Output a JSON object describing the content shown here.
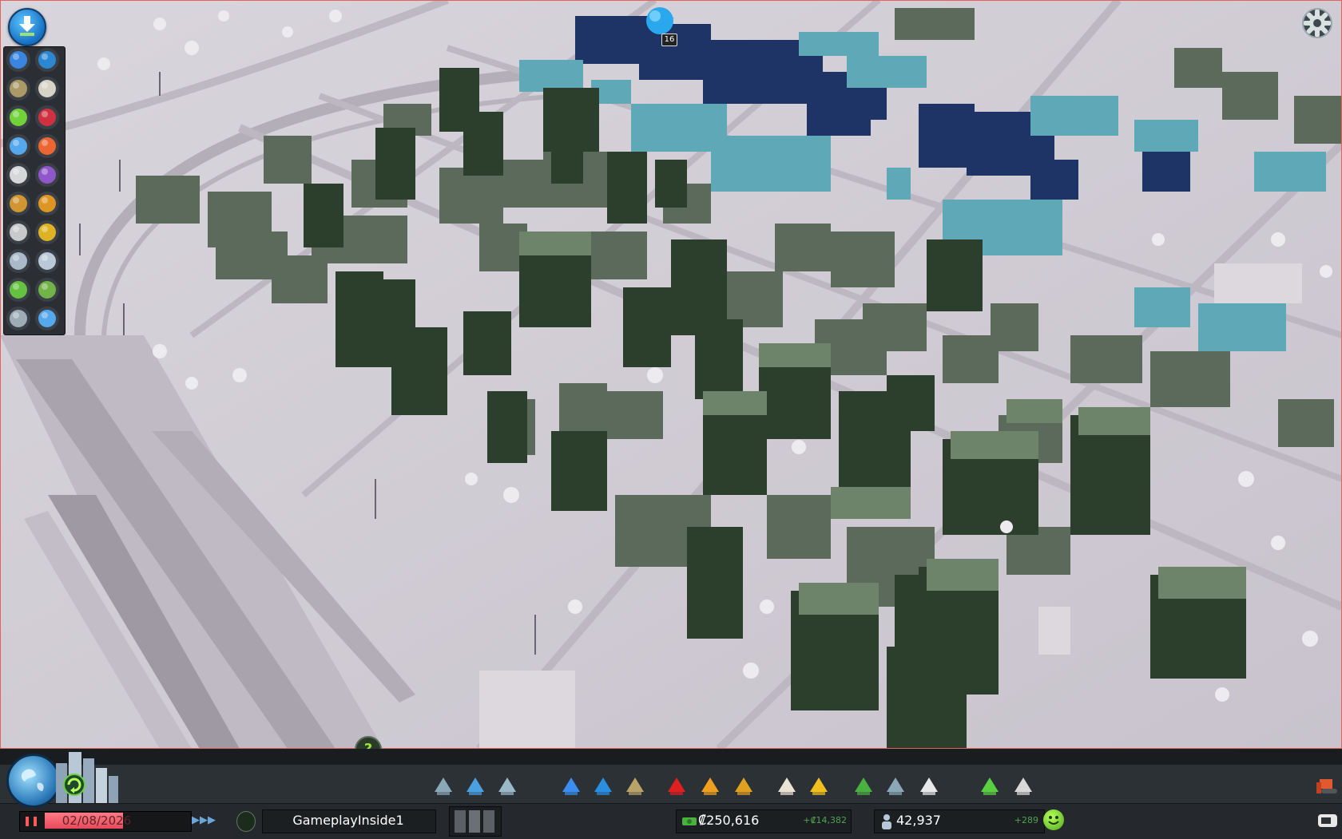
{
  "hud": {
    "date": "02/08/2026",
    "city_name": "GameplayInside1",
    "money": "₡250,616",
    "money_delta": "+₡14,382",
    "population": "42,937",
    "population_delta": "+289",
    "notification_count": "16",
    "help_label": "?"
  },
  "info_views": [
    {
      "icon": "electricity-icon",
      "color": "#3b8df0"
    },
    {
      "icon": "water-drop-icon",
      "color": "#2a8fe0"
    },
    {
      "icon": "garbage-icon",
      "color": "#b8a46a"
    },
    {
      "icon": "education-book-icon",
      "color": "#e9e3d4"
    },
    {
      "icon": "happiness-smiley-icon",
      "color": "#78e23a"
    },
    {
      "icon": "health-heart-icon",
      "color": "#e03040"
    },
    {
      "icon": "level-star-icon",
      "color": "#5ab4ff"
    },
    {
      "icon": "noise-cone-icon",
      "color": "#ff6a30"
    },
    {
      "icon": "traffic-car-icon",
      "color": "#e8e8e8"
    },
    {
      "icon": "pollution-canister-icon",
      "color": "#9a5ad8"
    },
    {
      "icon": "wind-magnet-icon",
      "color": "#e0a030"
    },
    {
      "icon": "fire-helmet-icon",
      "color": "#f0a020"
    },
    {
      "icon": "crime-mask-icon",
      "color": "#d8d8d8"
    },
    {
      "icon": "transport-bus-icon",
      "color": "#f0c020"
    },
    {
      "icon": "population-person-icon",
      "color": "#b8c8d8"
    },
    {
      "icon": "land-value-cube-icon",
      "color": "#c8d8e8"
    },
    {
      "icon": "economy-dollar-icon",
      "color": "#6ad040"
    },
    {
      "icon": "resources-leaf-icon",
      "color": "#78c048"
    },
    {
      "icon": "terrain-hills-icon",
      "color": "#aab8c4"
    },
    {
      "icon": "outside-clock-icon",
      "color": "#5ab4ff"
    }
  ],
  "toolbar": [
    {
      "icon": "roads-icon",
      "color": "#8aa8b8"
    },
    {
      "icon": "zoning-icon",
      "color": "#4aa0e0"
    },
    {
      "icon": "districts-icon",
      "color": "#9ab8c8"
    },
    {
      "icon": "electricity-tool-icon",
      "color": "#3b8df0"
    },
    {
      "icon": "water-tool-icon",
      "color": "#2a8fe0"
    },
    {
      "icon": "garbage-tool-icon",
      "color": "#b8a46a"
    },
    {
      "icon": "healthcare-tool-icon",
      "color": "#e02020"
    },
    {
      "icon": "fire-tool-icon",
      "color": "#f0a020"
    },
    {
      "icon": "police-tool-icon",
      "color": "#e0a020"
    },
    {
      "icon": "education-tool-icon",
      "color": "#e9e3d4"
    },
    {
      "icon": "public-transport-tool-icon",
      "color": "#f0c020"
    },
    {
      "icon": "beautification-tool-icon",
      "color": "#4ab040"
    },
    {
      "icon": "monuments-tool-icon",
      "color": "#8aa8b8"
    },
    {
      "icon": "wonders-tool-icon",
      "color": "#e8e8e8"
    },
    {
      "icon": "economy-tool-icon",
      "color": "#5ad040"
    },
    {
      "icon": "policies-tool-icon",
      "color": "#d8d8d8"
    }
  ]
}
